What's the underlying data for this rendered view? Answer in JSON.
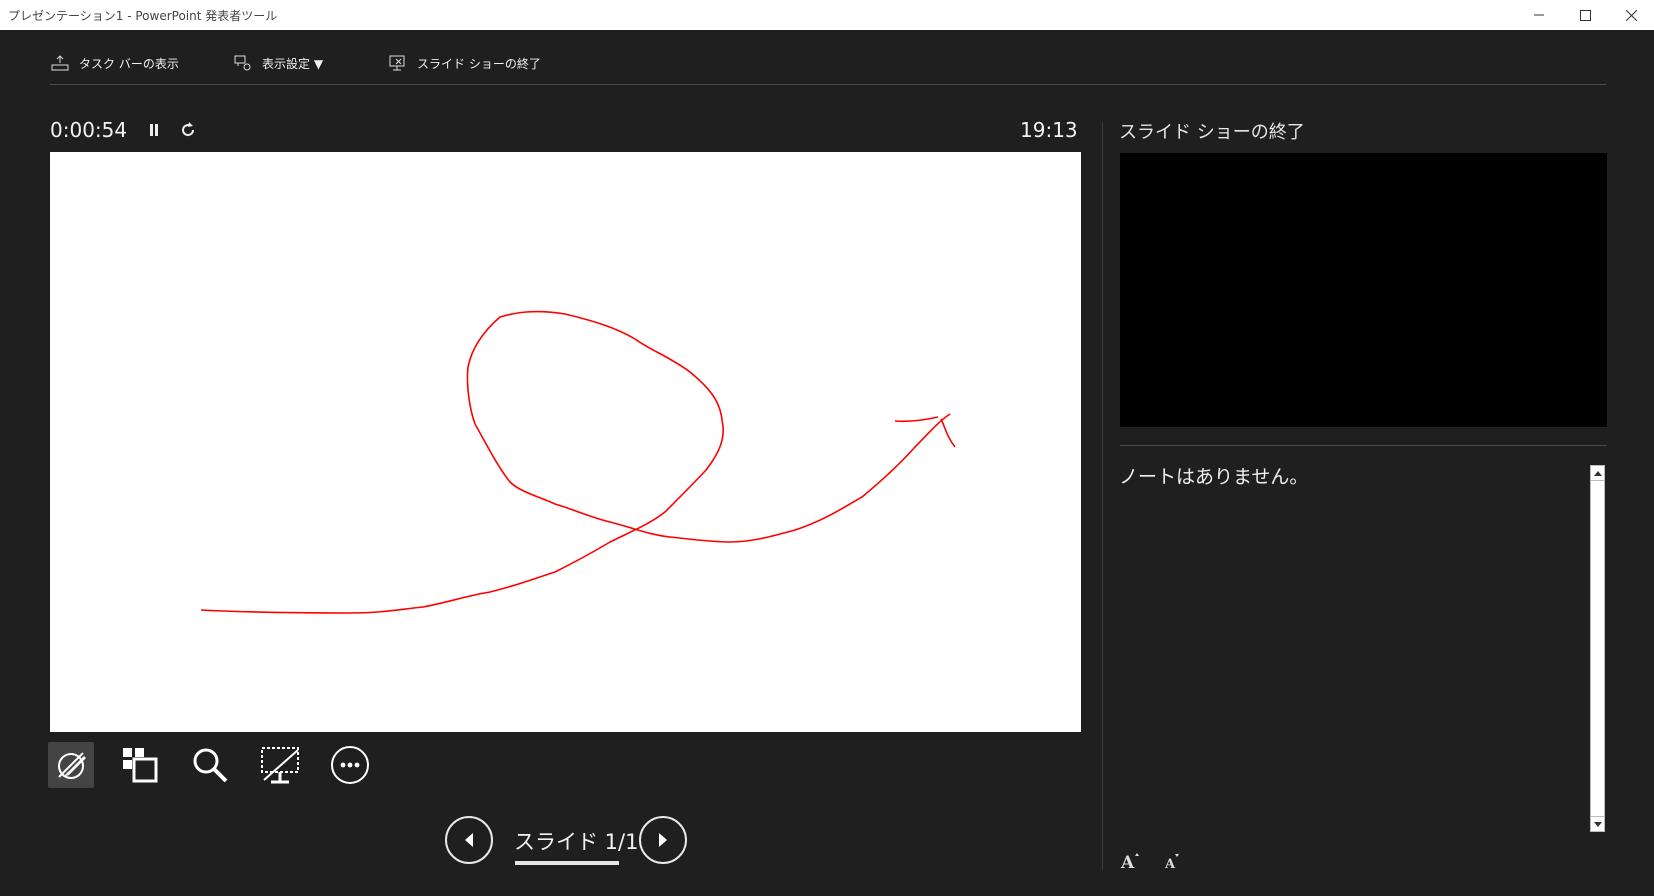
{
  "window": {
    "title": "プレゼンテーション1 - PowerPoint 発表者ツール"
  },
  "toolbar": {
    "taskbar_label": "タスク バーの表示",
    "display_settings_label": "表示設定 ▼",
    "end_show_label": "スライド ショーの終了"
  },
  "timer": {
    "elapsed": "0:00:54",
    "clock": "19:13"
  },
  "navigation": {
    "slide_counter": "スライド 1/1"
  },
  "next_slide": {
    "label": "スライド ショーの終了"
  },
  "notes": {
    "text": "ノートはありません。"
  },
  "slide": {
    "ink_color": "#ff0000",
    "background": "#ffffff"
  }
}
